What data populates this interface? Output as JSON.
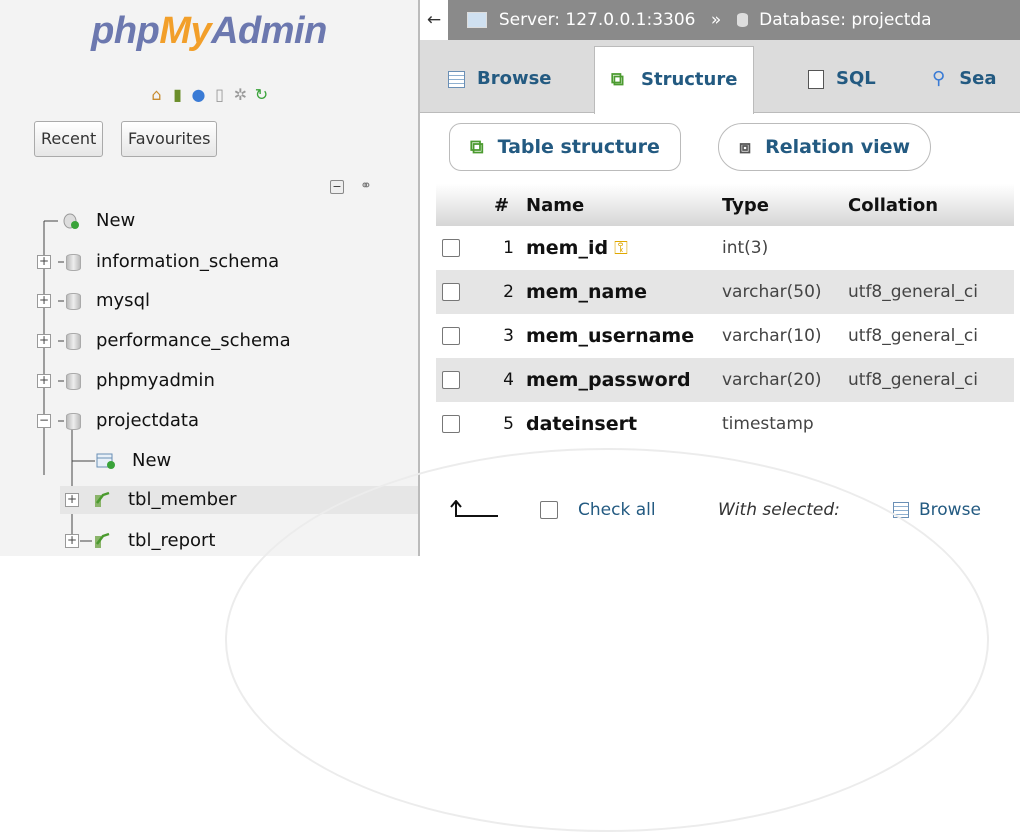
{
  "sidebar": {
    "logo": {
      "php": "php",
      "my": "My",
      "admin": "Admin"
    },
    "quick_icons": [
      {
        "icon": "home-icon",
        "glyph": "⌂",
        "color": "#c78b2e"
      },
      {
        "icon": "logout-icon",
        "glyph": "▮",
        "color": "#6b8e2b"
      },
      {
        "icon": "help-icon",
        "glyph": "●",
        "color": "#3a7bd5"
      },
      {
        "icon": "docs-icon",
        "glyph": "▯",
        "color": "#999999"
      },
      {
        "icon": "settings-icon",
        "glyph": "✲",
        "color": "#999999"
      },
      {
        "icon": "reload-icon",
        "glyph": "↻",
        "color": "#3aa33a"
      }
    ],
    "recent_label": "Recent",
    "favourites_label": "Favourites",
    "collapse_glyph": "−",
    "link_glyph": "⊖",
    "tree": [
      {
        "label": "New",
        "kind": "new"
      },
      {
        "label": "information_schema",
        "kind": "db",
        "expander": "+"
      },
      {
        "label": "mysql",
        "kind": "db",
        "expander": "+"
      },
      {
        "label": "performance_schema",
        "kind": "db",
        "expander": "+"
      },
      {
        "label": "phpmyadmin",
        "kind": "db",
        "expander": "+"
      },
      {
        "label": "projectdata",
        "kind": "db",
        "expander": "−"
      },
      {
        "label": "New",
        "kind": "new-table"
      },
      {
        "label": "tbl_member",
        "kind": "table",
        "expander": "+"
      },
      {
        "label": "tbl_report",
        "kind": "table",
        "expander": "+"
      }
    ]
  },
  "breadcrumb": {
    "back": "←",
    "server": "Server: 127.0.0.1:3306",
    "sep": "»",
    "database": "Database: projectda"
  },
  "tabs": [
    {
      "label": "Browse",
      "icon": "browse-icon"
    },
    {
      "label": "Structure",
      "icon": "structure-icon"
    },
    {
      "label": "SQL",
      "icon": "sql-icon"
    },
    {
      "label": "Sea",
      "icon": "search-icon"
    }
  ],
  "subtabs": {
    "table_structure": "Table structure",
    "relation_view": "Relation view"
  },
  "table": {
    "headers": [
      "#",
      "Name",
      "Type",
      "Collation"
    ],
    "rows": [
      {
        "num": "1",
        "name": "mem_id",
        "type": "int(3)",
        "collation": "",
        "primary": true
      },
      {
        "num": "2",
        "name": "mem_name",
        "type": "varchar(50)",
        "collation": "utf8_general_ci"
      },
      {
        "num": "3",
        "name": "mem_username",
        "type": "varchar(10)",
        "collation": "utf8_general_ci"
      },
      {
        "num": "4",
        "name": "mem_password",
        "type": "varchar(20)",
        "collation": "utf8_general_ci"
      },
      {
        "num": "5",
        "name": "dateinsert",
        "type": "timestamp",
        "collation": ""
      }
    ]
  },
  "footer": {
    "check_all": "Check all",
    "with_selected": "With selected:",
    "browse": "Browse"
  },
  "colors": {
    "link": "#235a81",
    "accent_orange": "#f29f2a",
    "logo_blue": "#6c78af"
  }
}
